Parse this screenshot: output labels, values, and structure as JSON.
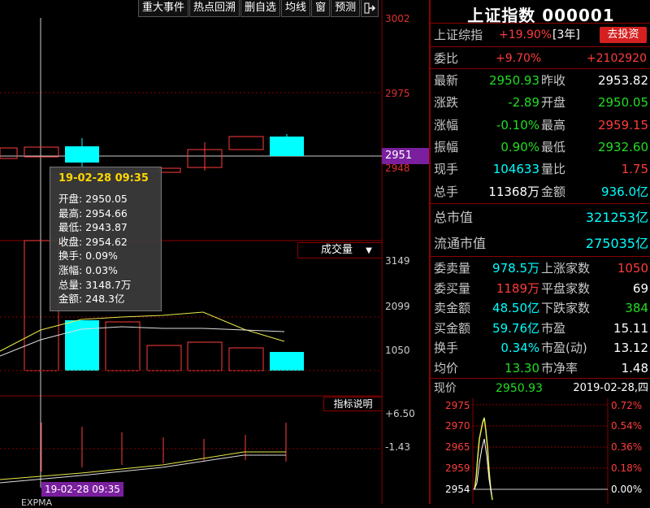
{
  "toolbar": {
    "items": [
      "重大事件",
      "热点回溯",
      "删自选",
      "均线",
      "窗",
      "预测"
    ],
    "nav_icon": "exit-icon"
  },
  "price_axis": {
    "top": "3002",
    "p2975": "2975",
    "current": "2951",
    "p2948": "2948"
  },
  "volume": {
    "label": "成交量",
    "ticks": [
      "3149",
      "2099",
      "1050"
    ]
  },
  "indicator": {
    "label": "指标说明",
    "ticks": [
      "+6.50",
      "-1.43"
    ],
    "date_label": "19-02-28 09:35",
    "bottom_label": "EXPMA"
  },
  "tooltip": {
    "title": "19-02-28 09:35",
    "rows": [
      "开盘: 2950.05",
      "最高: 2954.66",
      "最低: 2943.87",
      "收盘: 2954.62",
      "换手: 0.09%",
      "涨幅: 0.03%",
      "总量: 3148.7万",
      "金额: 248.3亿"
    ]
  },
  "panel": {
    "title": "上证指数 000001",
    "index_name": "上证综指",
    "index_change": "+19.90%",
    "index_period": "[3年]",
    "invest_button": "去投资",
    "weibi_label": "委比",
    "weibi_pct": "+9.70%",
    "weibi_val": "+2102920",
    "quote_rows": [
      {
        "l1": "最新",
        "v1": "2950.93",
        "c1": "green",
        "l2": "昨收",
        "v2": "2953.82",
        "c2": "white"
      },
      {
        "l1": "涨跌",
        "v1": "-2.89",
        "c1": "green",
        "l2": "开盘",
        "v2": "2950.05",
        "c2": "green"
      },
      {
        "l1": "涨幅",
        "v1": "-0.10%",
        "c1": "green",
        "l2": "最高",
        "v2": "2959.15",
        "c2": "red"
      },
      {
        "l1": "振幅",
        "v1": "0.90%",
        "c1": "green",
        "l2": "最低",
        "v2": "2932.60",
        "c2": "green"
      },
      {
        "l1": "现手",
        "v1": "104633",
        "c1": "cyan",
        "l2": "量比",
        "v2": "1.75",
        "c2": "red"
      },
      {
        "l1": "总手",
        "v1": "11368万",
        "c1": "white",
        "l2": "金额",
        "v2": "936.0亿",
        "c2": "cyan"
      }
    ],
    "market_cap_label": "总市值",
    "market_cap": "321253亿",
    "float_cap_label": "流通市值",
    "float_cap": "275035亿",
    "stat_rows": [
      {
        "l1": "委卖量",
        "v1": "978.5万",
        "c1": "cyan",
        "l2": "上涨家数",
        "v2": "1050",
        "c2": "red"
      },
      {
        "l1": "委买量",
        "v1": "1189万",
        "c1": "red",
        "l2": "平盘家数",
        "v2": "69",
        "c2": "white"
      },
      {
        "l1": "卖金额",
        "v1": "48.50亿",
        "c1": "cyan",
        "l2": "下跌家数",
        "v2": "384",
        "c2": "green"
      },
      {
        "l1": "买金额",
        "v1": "59.76亿",
        "c1": "cyan",
        "l2": "市盈",
        "v2": "15.11",
        "c2": "white"
      },
      {
        "l1": "换手",
        "v1": "0.34%",
        "c1": "cyan",
        "l2": "市盈(动)",
        "v2": "13.12",
        "c2": "white"
      },
      {
        "l1": "均价",
        "v1": "13.30",
        "c1": "green",
        "l2": "市净率",
        "v2": "1.48",
        "c2": "white"
      }
    ],
    "current_label": "现价",
    "current_price": "2950.93",
    "date": "2019-02-28,四",
    "mini_left": [
      "2975",
      "2970",
      "2965",
      "2959",
      "2954"
    ],
    "mini_right": [
      "0.72%",
      "0.54%",
      "0.36%",
      "0.18%",
      "0.00%"
    ]
  },
  "colors": {
    "up": "#ff3c3c",
    "down": "#00ffff",
    "grid": "#8b0000",
    "green": "#22dd22"
  }
}
